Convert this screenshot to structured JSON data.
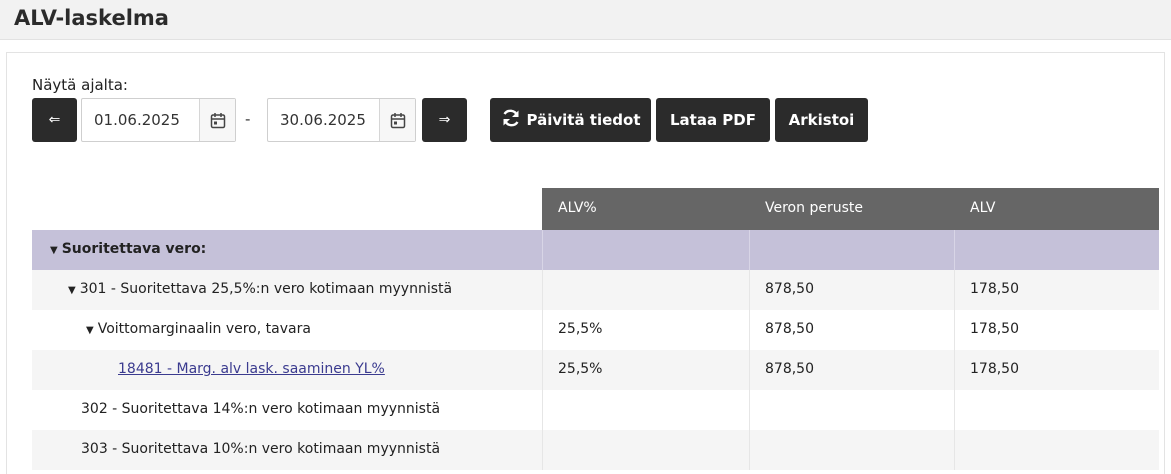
{
  "header": {
    "title": "ALV-laskelma"
  },
  "filter": {
    "label": "Näytä ajalta:",
    "prev_label": "⇐",
    "next_label": "⇒",
    "from_date": "01.06.2025",
    "to_date": "30.06.2025",
    "separator": "-"
  },
  "actions": {
    "refresh_label": "Päivitä tiedot",
    "pdf_label": "Lataa PDF",
    "archive_label": "Arkistoi"
  },
  "table": {
    "columns": [
      "",
      "ALV%",
      "Veron peruste",
      "ALV"
    ],
    "rows": [
      {
        "label": "Suoritettava vero:",
        "caret": "▼",
        "rate": "",
        "base": "",
        "vat": ""
      },
      {
        "label": "301 - Suoritettava 25,5%:n vero kotimaan myynnistä",
        "caret": "▼",
        "rate": "",
        "base": "878,50",
        "vat": "178,50"
      },
      {
        "label": "Voittomarginaalin vero, tavara",
        "caret": "▼",
        "rate": "25,5%",
        "base": "878,50",
        "vat": "178,50"
      },
      {
        "label": "18481 - Marg. alv lask. saaminen YL%",
        "caret": "",
        "rate": "25,5%",
        "base": "878,50",
        "vat": "178,50"
      },
      {
        "label": "302 - Suoritettava 14%:n vero kotimaan myynnistä",
        "caret": "",
        "rate": "",
        "base": "",
        "vat": ""
      },
      {
        "label": "303 - Suoritettava 10%:n vero kotimaan myynnistä",
        "caret": "",
        "rate": "",
        "base": "",
        "vat": ""
      }
    ]
  },
  "colors": {
    "header_bg": "#666666",
    "group_bg": "#c5c1d9",
    "button_bg": "#2b2b2b",
    "link": "#3b3b8f"
  },
  "icons": {
    "calendar": "calendar-icon",
    "refresh": "refresh-icon"
  }
}
